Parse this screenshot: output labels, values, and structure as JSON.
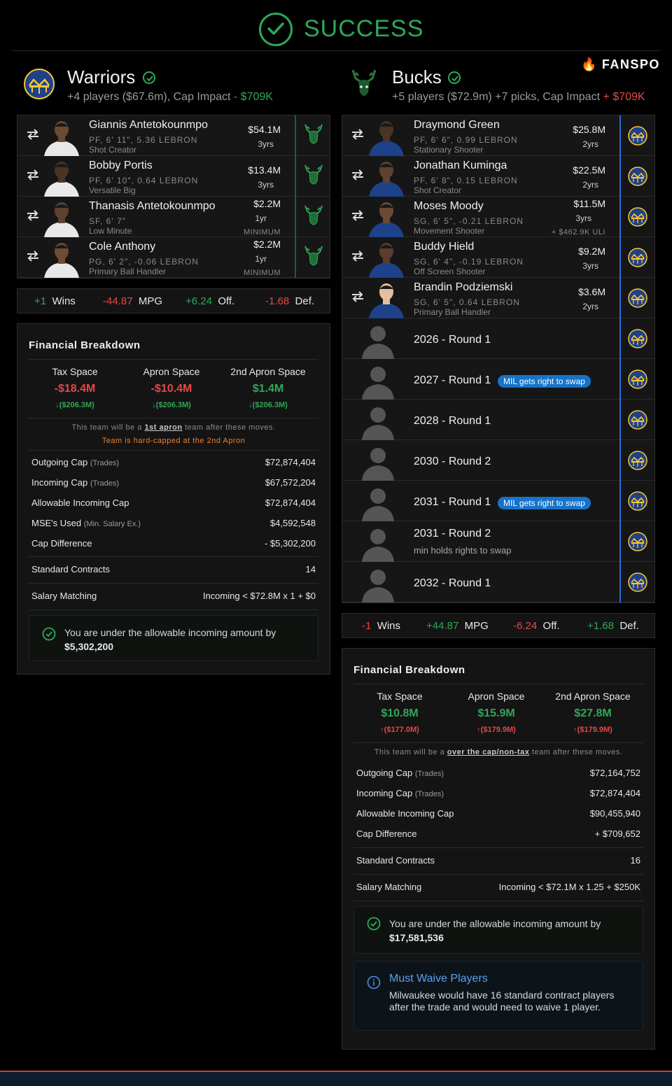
{
  "status": {
    "title": "SUCCESS"
  },
  "brand": {
    "name": "FANSPO"
  },
  "colors": {
    "green": "#2fa857",
    "red": "#e54848",
    "blue_pill": "#1673c9",
    "orange": "#e8803a"
  },
  "warriors": {
    "name": "Warriors",
    "summary_prefix": "+4 players ($67.6m), Cap Impact",
    "summary_impact": "- $709K",
    "players": [
      {
        "name": "Giannis Antetokounmpo",
        "desc": "PF, 6' 11\", 5.36 LEBRON",
        "role": "Shot Creator",
        "salary": "$54.1M",
        "years": "3yrs",
        "note": ""
      },
      {
        "name": "Bobby Portis",
        "desc": "PF, 6' 10\", 0.64 LEBRON",
        "role": "Versatile Big",
        "salary": "$13.4M",
        "years": "3yrs",
        "note": ""
      },
      {
        "name": "Thanasis Antetokounmpo",
        "desc": "SF, 6' 7\"",
        "role": "Low Minute",
        "salary": "$2.2M",
        "years": "1yr",
        "note": "MINIMUM"
      },
      {
        "name": "Cole Anthony",
        "desc": "PG, 6' 2\", -0.06 LEBRON",
        "role": "Primary Ball Handler",
        "salary": "$2.2M",
        "years": "1yr",
        "note": "MINIMUM"
      }
    ],
    "stats": {
      "wins_val": "+1",
      "wins_lbl": "Wins",
      "mpg_val": "-44.87",
      "mpg_lbl": "MPG",
      "off_val": "+6.24",
      "off_lbl": "Off.",
      "def_val": "-1.68",
      "def_lbl": "Def."
    },
    "financial": {
      "title": "Financial Breakdown",
      "spaces": [
        {
          "label": "Tax Space",
          "value": "-$18.4M",
          "delta": "($206.3M)"
        },
        {
          "label": "Apron Space",
          "value": "-$10.4M",
          "delta": "($206.3M)"
        },
        {
          "label": "2nd Apron Space",
          "value": "$1.4M",
          "delta": "($206.3M)"
        }
      ],
      "note_pre": "This team will be a",
      "note_link": "1st apron",
      "note_post": "team after these moves.",
      "hardcap": "Team is hard-capped at the 2nd Apron",
      "rows": [
        {
          "label": "Outgoing Cap",
          "sub": "(Trades)",
          "value": "$72,874,404"
        },
        {
          "label": "Incoming Cap",
          "sub": "(Trades)",
          "value": "$67,572,204"
        },
        {
          "label": "Allowable Incoming Cap",
          "sub": "",
          "value": "$72,874,404"
        },
        {
          "label": "MSE's Used",
          "sub": "(Min. Salary Ex.)",
          "value": "$4,592,548"
        },
        {
          "label": "Cap Difference",
          "sub": "",
          "value": "- $5,302,200"
        }
      ],
      "contracts_label": "Standard Contracts",
      "contracts_value": "14",
      "matching_label": "Salary Matching",
      "matching_value": "Incoming < $72.8M x 1 + $0",
      "callout_text": "You are under the allowable incoming amount by",
      "callout_amount": "$5,302,200"
    }
  },
  "bucks": {
    "name": "Bucks",
    "summary_prefix": "+5 players ($72.9m) +7 picks, Cap Impact",
    "summary_impact": "+ $709K",
    "players": [
      {
        "name": "Draymond Green",
        "desc": "PF, 6' 6\", 0.99 LEBRON",
        "role": "Stationary Shooter",
        "salary": "$25.8M",
        "years": "2yrs",
        "note": ""
      },
      {
        "name": "Jonathan Kuminga",
        "desc": "PF, 6' 8\", 0.15 LEBRON",
        "role": "Shot Creator",
        "salary": "$22.5M",
        "years": "2yrs",
        "note": ""
      },
      {
        "name": "Moses Moody",
        "desc": "SG, 6' 5\", -0.21 LEBRON",
        "role": "Movement Shooter",
        "salary": "$11.5M",
        "years": "3yrs",
        "note": "+ $462.9K ULI"
      },
      {
        "name": "Buddy Hield",
        "desc": "SG, 6' 4\", -0.19 LEBRON",
        "role": "Off Screen Shooter",
        "salary": "$9.2M",
        "years": "3yrs",
        "note": ""
      },
      {
        "name": "Brandin Podziemski",
        "desc": "SG, 6' 5\", 0.64 LEBRON",
        "role": "Primary Ball Handler",
        "salary": "$3.6M",
        "years": "2yrs",
        "note": ""
      }
    ],
    "picks": [
      {
        "name": "2026 - Round 1",
        "pill": "",
        "sub": ""
      },
      {
        "name": "2027 - Round 1",
        "pill": "MIL gets right to swap",
        "sub": ""
      },
      {
        "name": "2028 - Round 1",
        "pill": "",
        "sub": ""
      },
      {
        "name": "2030 - Round 2",
        "pill": "",
        "sub": ""
      },
      {
        "name": "2031 - Round 1",
        "pill": "MIL gets right to swap",
        "sub": ""
      },
      {
        "name": "2031 - Round 2",
        "pill": "",
        "sub": "min holds rights to swap"
      },
      {
        "name": "2032 - Round 1",
        "pill": "",
        "sub": ""
      }
    ],
    "stats": {
      "wins_val": "-1",
      "wins_lbl": "Wins",
      "mpg_val": "+44.87",
      "mpg_lbl": "MPG",
      "off_val": "-6.24",
      "off_lbl": "Off.",
      "def_val": "+1.68",
      "def_lbl": "Def."
    },
    "financial": {
      "title": "Financial Breakdown",
      "spaces": [
        {
          "label": "Tax Space",
          "value": "$10.8M",
          "delta": "($177.0M)"
        },
        {
          "label": "Apron Space",
          "value": "$15.9M",
          "delta": "($179.9M)"
        },
        {
          "label": "2nd Apron Space",
          "value": "$27.8M",
          "delta": "($179.9M)"
        }
      ],
      "note_pre": "This team will be a",
      "note_link": "over the cap/non-tax",
      "note_post": "team after these moves.",
      "rows": [
        {
          "label": "Outgoing Cap",
          "sub": "(Trades)",
          "value": "$72,164,752"
        },
        {
          "label": "Incoming Cap",
          "sub": "(Trades)",
          "value": "$72,874,404"
        },
        {
          "label": "Allowable Incoming Cap",
          "sub": "",
          "value": "$90,455,940"
        },
        {
          "label": "Cap Difference",
          "sub": "",
          "value": "+ $709,652"
        }
      ],
      "contracts_label": "Standard Contracts",
      "contracts_value": "16",
      "matching_label": "Salary Matching",
      "matching_value": "Incoming < $72.1M x 1.25 + $250K",
      "callout_text": "You are under the allowable incoming amount by",
      "callout_amount": "$17,581,536",
      "waive_title": "Must Waive Players",
      "waive_text1": "Milwaukee would have 16 standard contract players",
      "waive_text2": "after the trade and would need to waive 1 player."
    }
  }
}
